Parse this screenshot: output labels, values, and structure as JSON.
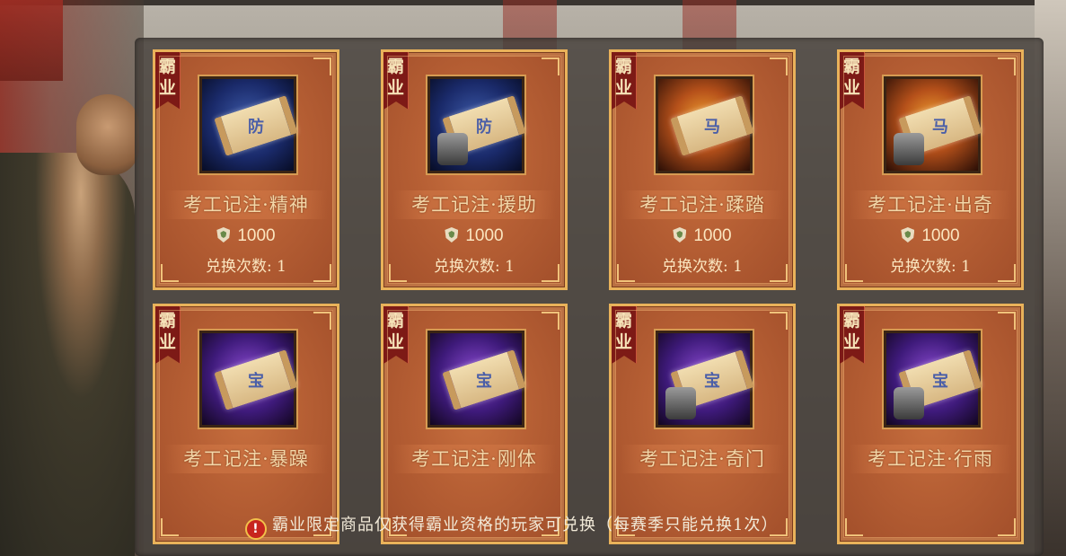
{
  "shop": {
    "cards": [
      {
        "badge": "霸业",
        "name": "考工记注·精神",
        "price": "1000",
        "exchange": "兑换次数: 1",
        "icon_glyph": "防",
        "icon_style": "blue",
        "extra": false
      },
      {
        "badge": "霸业",
        "name": "考工记注·援助",
        "price": "1000",
        "exchange": "兑换次数: 1",
        "icon_glyph": "防",
        "icon_style": "blue",
        "extra": true
      },
      {
        "badge": "霸业",
        "name": "考工记注·蹂踏",
        "price": "1000",
        "exchange": "兑换次数: 1",
        "icon_glyph": "马",
        "icon_style": "fire",
        "extra": false
      },
      {
        "badge": "霸业",
        "name": "考工记注·出奇",
        "price": "1000",
        "exchange": "兑换次数: 1",
        "icon_glyph": "马",
        "icon_style": "fire",
        "extra": true
      },
      {
        "badge": "霸业",
        "name": "考工记注·暴躁",
        "icon_glyph": "宝",
        "icon_style": "purple",
        "extra": false
      },
      {
        "badge": "霸业",
        "name": "考工记注·刚体",
        "icon_glyph": "宝",
        "icon_style": "purple",
        "extra": false
      },
      {
        "badge": "霸业",
        "name": "考工记注·奇门",
        "icon_glyph": "宝",
        "icon_style": "purple",
        "extra": true
      },
      {
        "badge": "霸业",
        "name": "考工记注·行雨",
        "icon_glyph": "宝",
        "icon_style": "purple",
        "extra": true
      }
    ]
  },
  "notice": {
    "icon": "alert-icon",
    "icon_text": "!",
    "text": "霸业限定商品仅获得霸业资格的玩家可兑换（每赛季只能兑换1次）"
  },
  "colors": {
    "card_border": "#e9b25a",
    "card_bg": "#b65f34",
    "ribbon": "#7d1a16",
    "alert": "#c7251e"
  }
}
